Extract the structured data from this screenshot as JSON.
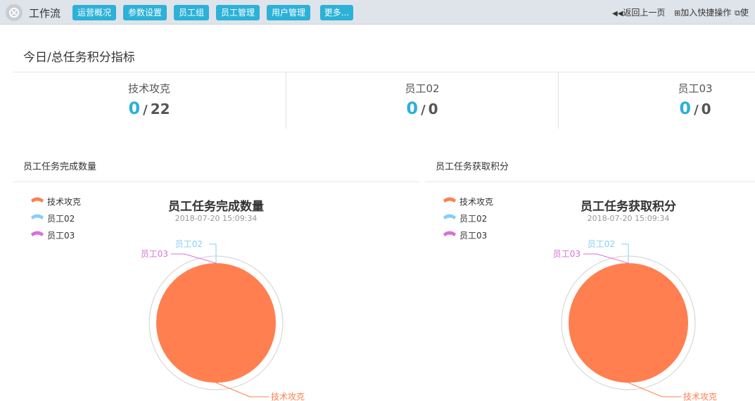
{
  "app": {
    "title": "工作流"
  },
  "nav": [
    {
      "label": "运营概况"
    },
    {
      "label": "参数设置"
    },
    {
      "label": "员工组"
    },
    {
      "label": "员工管理"
    },
    {
      "label": "用户管理"
    },
    {
      "label": "更多..."
    }
  ],
  "toplinks": {
    "back": "返回上一页",
    "shortcut": "加入快捷操作",
    "use": "使"
  },
  "kpi": {
    "title": "今日/总任务积分指标",
    "items": [
      {
        "name": "技术攻克",
        "current": "0",
        "total": "22"
      },
      {
        "name": "员工02",
        "current": "0",
        "total": "0"
      },
      {
        "name": "员工03",
        "current": "0",
        "total": "0"
      }
    ]
  },
  "panels": [
    {
      "title": "员工任务完成数量"
    },
    {
      "title": "员工任务获取积分"
    }
  ],
  "chart_data": [
    {
      "type": "pie",
      "title": "员工任务完成数量",
      "subtitle": "2018-07-20 15:09:34",
      "legend_position": "top-left",
      "slices": [
        {
          "name": "技术攻克",
          "value": 100,
          "color": "#ff7f50"
        },
        {
          "name": "员工02",
          "value": 0,
          "color": "#87cefa"
        },
        {
          "name": "员工03",
          "value": 0,
          "color": "#da70d6"
        }
      ]
    },
    {
      "type": "pie",
      "title": "员工任务获取积分",
      "subtitle": "2018-07-20 15:09:34",
      "legend_position": "top-left",
      "slices": [
        {
          "name": "技术攻克",
          "value": 100,
          "color": "#ff7f50"
        },
        {
          "name": "员工02",
          "value": 0,
          "color": "#87cefa"
        },
        {
          "name": "员工03",
          "value": 0,
          "color": "#da70d6"
        }
      ]
    }
  ]
}
